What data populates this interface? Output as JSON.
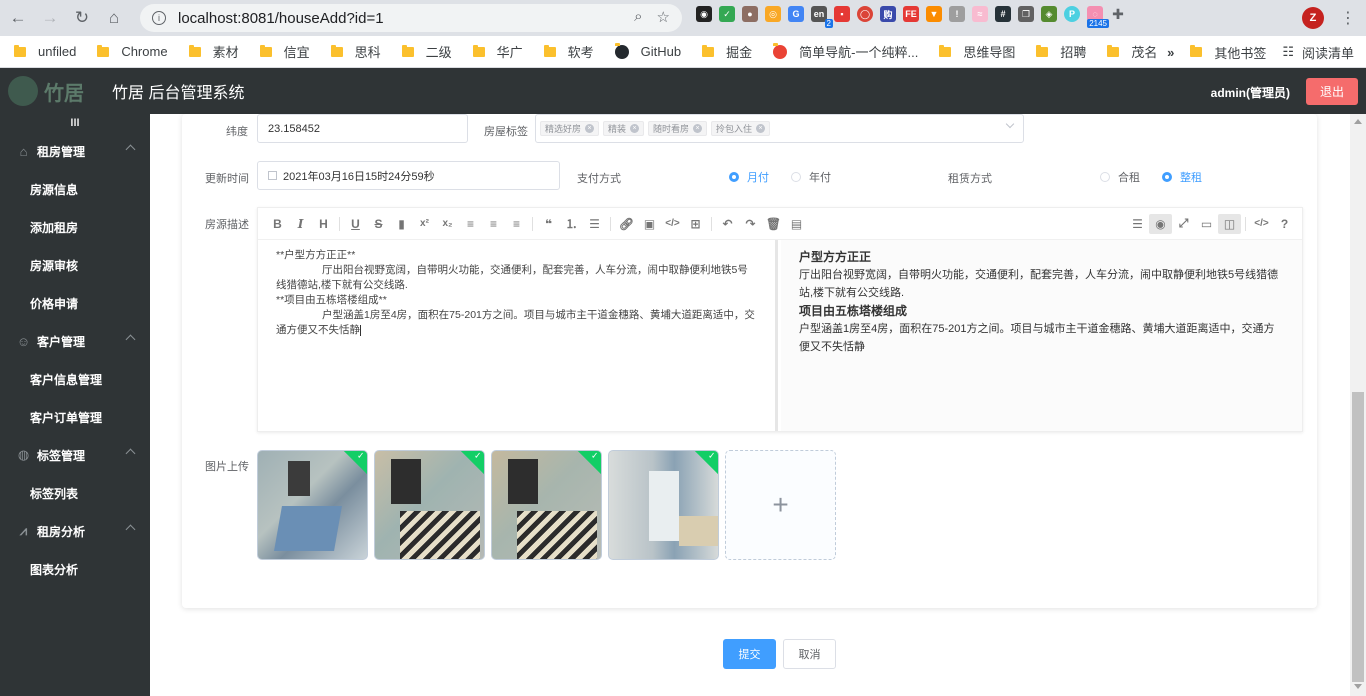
{
  "browser": {
    "url": "localhost:8081/houseAdd?id=1",
    "bookmarks": [
      "unfiled",
      "Chrome",
      "素材",
      "信宜",
      "思科",
      "二级",
      "华广",
      "软考",
      "GitHub",
      "掘金",
      "简单导航-一个纯粹...",
      "思维导图",
      "招聘",
      "茂名"
    ],
    "bookmarks_more": "»",
    "other_bookmarks": "其他书签",
    "reading_list": "阅读清单",
    "ext_badge_en": "2",
    "ext_badge_count": "2145",
    "avatar_letter": "Z"
  },
  "header": {
    "logo_text": "竹居",
    "title": "竹居 后台管理系统",
    "user": "admin(管理员)",
    "logout": "退出"
  },
  "sidebar": {
    "collapse": "III",
    "groups": [
      {
        "label": "租房管理",
        "icon": "house-icon",
        "items": [
          "房源信息",
          "添加租房",
          "房源审核",
          "价格申请"
        ]
      },
      {
        "label": "客户管理",
        "icon": "user-icon",
        "items": [
          "客户信息管理",
          "客户订单管理"
        ]
      },
      {
        "label": "标签管理",
        "icon": "tag-icon",
        "items": [
          "标签列表"
        ]
      },
      {
        "label": "租房分析",
        "icon": "chart-icon",
        "items": [
          "图表分析"
        ]
      }
    ]
  },
  "form": {
    "lat_label": "纬度",
    "lat_value": "23.158452",
    "tags_label": "房屋标签",
    "tags": [
      "精选好房",
      "精装",
      "随时看房",
      "拎包入住"
    ],
    "update_label": "更新时间",
    "update_value": "2021年03月16日15时24分59秒",
    "pay_label": "支付方式",
    "pay_options": [
      "月付",
      "年付"
    ],
    "pay_selected": "月付",
    "rent_label": "租赁方式",
    "rent_options": [
      "合租",
      "整租"
    ],
    "rent_selected": "整租",
    "desc_label": "房源描述",
    "md_lines": [
      "**户型方方正正**",
      "厅出阳台视野宽阔，自带明火功能，交通便利，配套完善，人车分流，闹中取静便利地铁5号",
      "线猎德站,楼下就有公交线路.",
      "**项目由五栋塔楼组成**",
      "户型涵盖1房至4房，面积在75-201方之间。项目与城市主干道金穗路、黄埔大道距离适中，交",
      "通方便又不失恬静"
    ],
    "preview": {
      "h1": "户型方方正正",
      "p1": "厅出阳台视野宽阔，自带明火功能，交通便利，配套完善，人车分流，闹中取静便利地铁5号线猎德站,楼下就有公交线路.",
      "h2": "项目由五栋塔楼组成",
      "p2": "户型涵盖1房至4房，面积在75-201方之间。项目与城市主干道金穗路、黄埔大道距离适中，交通方便又不失恬静"
    },
    "upload_label": "图片上传",
    "upload_plus": "+",
    "submit": "提交",
    "cancel": "取消"
  },
  "colors": {
    "primary": "#409eff",
    "danger": "#f56c6c",
    "sidebar": "#2f3436",
    "success": "#13ce66"
  }
}
